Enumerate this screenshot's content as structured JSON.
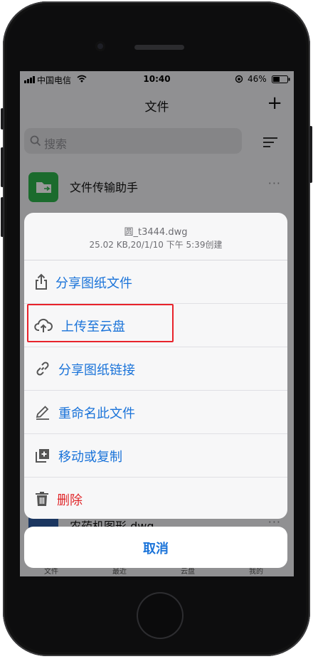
{
  "status": {
    "carrier": "中国电信",
    "time": "10:40",
    "battery": "46%"
  },
  "nav": {
    "title": "文件",
    "add_symbol": "+"
  },
  "search": {
    "placeholder": "搜索"
  },
  "list": {
    "first_item": "文件传输助手",
    "partial_item": "农药机图形.dwg",
    "more_symbol": "···"
  },
  "tabs": [
    "文件",
    "最近",
    "云盘",
    "我的"
  ],
  "sheet": {
    "file_name": "圆_t3444.dwg",
    "file_meta": "25.02 KB,20/1/10 下午 5:39创建",
    "actions": [
      {
        "label": "分享图纸文件",
        "icon": "share-icon"
      },
      {
        "label": "上传至云盘",
        "icon": "cloud-upload-icon"
      },
      {
        "label": "分享图纸链接",
        "icon": "link-icon"
      },
      {
        "label": "重命名此文件",
        "icon": "pencil-icon"
      },
      {
        "label": "移动或复制",
        "icon": "copy-icon"
      },
      {
        "label": "删除",
        "icon": "trash-icon"
      }
    ],
    "cancel": "取消"
  },
  "colors": {
    "action_blue": "#1a73d9",
    "destructive_red": "#e0272a",
    "highlight_red": "#e8232b",
    "folder_green": "#2eb24b"
  }
}
